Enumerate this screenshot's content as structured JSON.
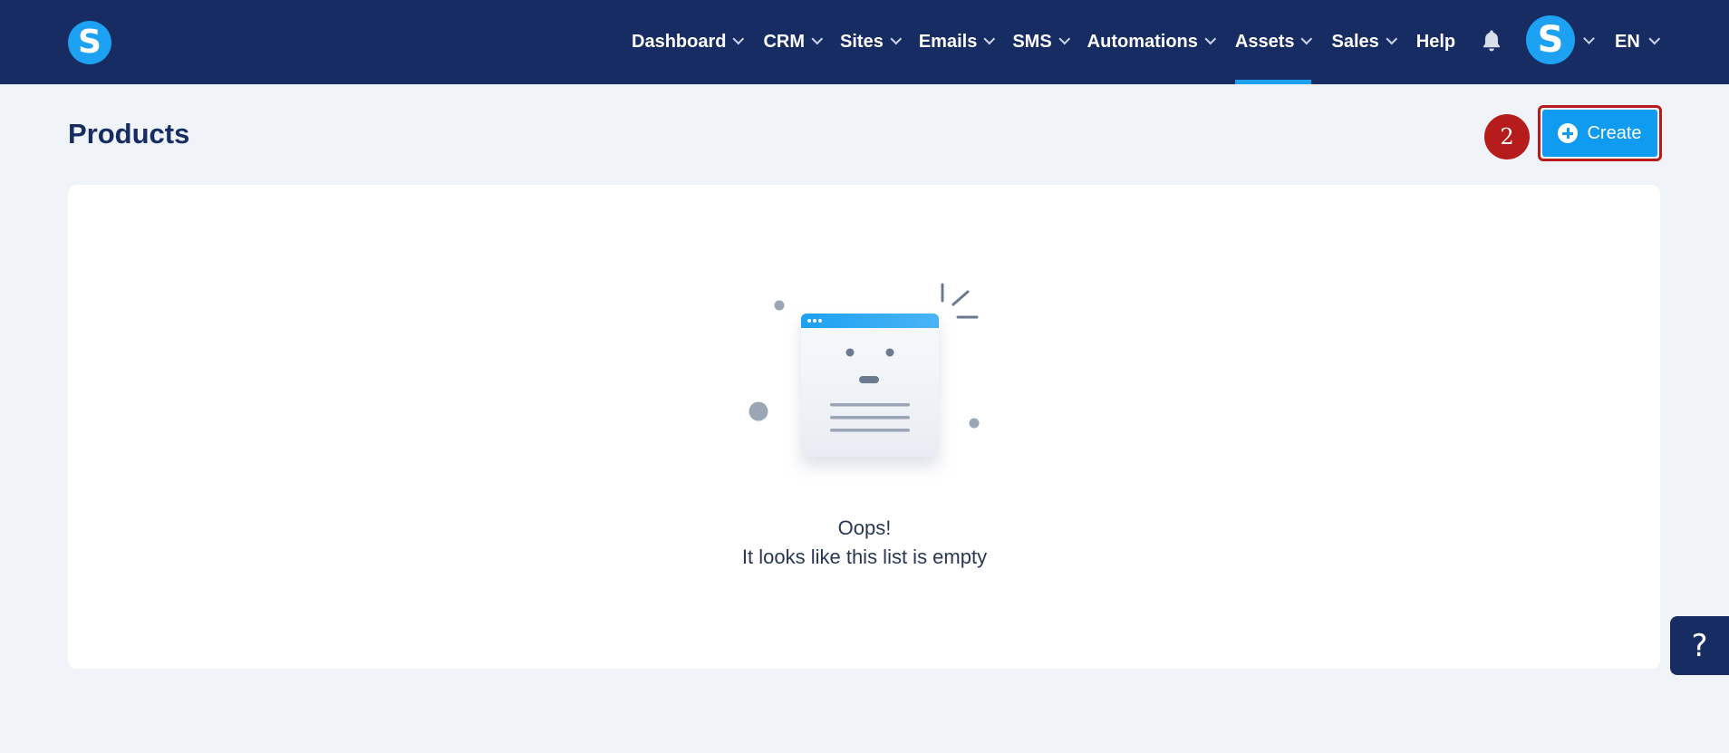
{
  "app": {
    "logo_letter": "S",
    "brand_color": "#1da1f2",
    "nav_bg": "#172c63"
  },
  "nav": {
    "items": [
      {
        "label": "Dashboard",
        "has_dropdown": true,
        "active": false
      },
      {
        "label": "CRM",
        "has_dropdown": true,
        "active": false
      },
      {
        "label": "Sites",
        "has_dropdown": true,
        "active": false
      },
      {
        "label": "Emails",
        "has_dropdown": true,
        "active": false
      },
      {
        "label": "SMS",
        "has_dropdown": true,
        "active": false
      },
      {
        "label": "Automations",
        "has_dropdown": true,
        "active": false
      },
      {
        "label": "Assets",
        "has_dropdown": true,
        "active": true
      },
      {
        "label": "Sales",
        "has_dropdown": true,
        "active": false
      },
      {
        "label": "Help",
        "has_dropdown": false,
        "active": false
      }
    ],
    "bell_icon": "bell-icon",
    "avatar_letter": "S",
    "language": "EN"
  },
  "page": {
    "title": "Products",
    "step_number": "2",
    "create_label": "Create",
    "create_icon": "plus-circle-icon"
  },
  "empty_state": {
    "title": "Oops!",
    "message": "It looks like this list is empty"
  },
  "help_widget": {
    "label": "?"
  }
}
